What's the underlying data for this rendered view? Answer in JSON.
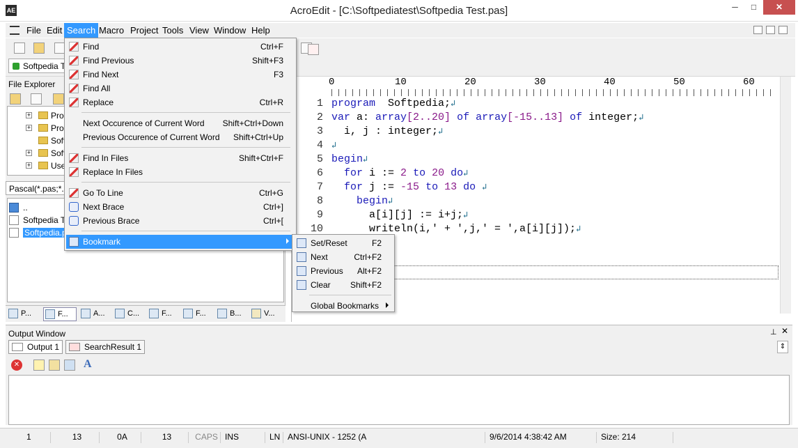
{
  "window": {
    "title": "AcroEdit - [C:\\Softpediatest\\Softpedia Test.pas]",
    "minimize": "─",
    "maximize": "□",
    "close": "✕",
    "app_icon": "AE"
  },
  "menubar": {
    "items": [
      "File",
      "Edit",
      "Search",
      "Macro",
      "Project",
      "Tools",
      "View",
      "Window",
      "Help"
    ],
    "active": "Search"
  },
  "doc_tab": {
    "label": "Softpedia T"
  },
  "file_explorer": {
    "title": "File Explorer",
    "tree": [
      "Prog",
      "Prog",
      "Soft",
      "Soft",
      "Use"
    ],
    "filter": "Pascal(*.pas;*.d",
    "files": [
      {
        "label": "..",
        "selected": false
      },
      {
        "label": "Softpedia T",
        "selected": false
      },
      {
        "label": "Softpedia.p",
        "selected": true
      }
    ],
    "panel_tabs": [
      "P...",
      "F...",
      "A...",
      "C...",
      "F...",
      "F...",
      "B...",
      "V..."
    ]
  },
  "editor": {
    "ruler_labels": [
      "0",
      "10",
      "20",
      "30",
      "40",
      "50",
      "60"
    ],
    "lines": [
      {
        "n": "1",
        "parts": [
          [
            "kw",
            "program"
          ],
          [
            "",
            "  Softpedia;"
          ],
          [
            "ret",
            "↲"
          ]
        ]
      },
      {
        "n": "2",
        "parts": [
          [
            "kw",
            "var"
          ],
          [
            "",
            " a: "
          ],
          [
            "kw",
            "array"
          ],
          [
            "num",
            "[2..20]"
          ],
          [
            "",
            " "
          ],
          [
            "kw",
            "of"
          ],
          [
            "",
            " "
          ],
          [
            "kw",
            "array"
          ],
          [
            "num",
            "[-15..13]"
          ],
          [
            "",
            " "
          ],
          [
            "kw",
            "of"
          ],
          [
            "",
            " integer;"
          ],
          [
            "ret",
            "↲"
          ]
        ]
      },
      {
        "n": "3",
        "parts": [
          [
            "",
            "  i, j : integer;"
          ],
          [
            "ret",
            "↲"
          ]
        ]
      },
      {
        "n": "4",
        "parts": [
          [
            "ret",
            "↲"
          ]
        ]
      },
      {
        "n": "5",
        "parts": [
          [
            "kw",
            "begin"
          ],
          [
            "ret",
            "↲"
          ]
        ]
      },
      {
        "n": "6",
        "parts": [
          [
            "",
            "  "
          ],
          [
            "kw",
            "for"
          ],
          [
            "",
            " i := "
          ],
          [
            "num",
            "2"
          ],
          [
            "",
            " "
          ],
          [
            "kw",
            "to"
          ],
          [
            "",
            " "
          ],
          [
            "num",
            "20"
          ],
          [
            "",
            " "
          ],
          [
            "kw",
            "do"
          ],
          [
            "ret",
            "↲"
          ]
        ]
      },
      {
        "n": "7",
        "parts": [
          [
            "",
            "  "
          ],
          [
            "kw",
            "for"
          ],
          [
            "",
            " j := "
          ],
          [
            "num",
            "-15"
          ],
          [
            "",
            " "
          ],
          [
            "kw",
            "to"
          ],
          [
            "",
            " "
          ],
          [
            "num",
            "13"
          ],
          [
            "",
            " "
          ],
          [
            "kw",
            "do"
          ],
          [
            "",
            " "
          ],
          [
            "ret",
            "↲"
          ]
        ]
      },
      {
        "n": "8",
        "parts": [
          [
            "",
            "    "
          ],
          [
            "kw",
            "begin"
          ],
          [
            "ret",
            "↲"
          ]
        ]
      },
      {
        "n": "9",
        "parts": [
          [
            "",
            "      a[i][j] := i+j;"
          ],
          [
            "ret",
            "↲"
          ]
        ]
      },
      {
        "n": "10",
        "parts": [
          [
            "",
            "      writeln(i,' + ',j,' = ',a[i][j]);"
          ],
          [
            "ret",
            "↲"
          ]
        ]
      }
    ]
  },
  "search_menu": {
    "items": [
      {
        "label": "Find",
        "shortcut": "Ctrl+F",
        "icon": "find-icon"
      },
      {
        "label": "Find Previous",
        "shortcut": "Shift+F3",
        "icon": "find-previous-icon"
      },
      {
        "label": "Find Next",
        "shortcut": "F3",
        "icon": "find-next-icon"
      },
      {
        "label": "Find All",
        "shortcut": "",
        "icon": "find-all-icon"
      },
      {
        "label": "Replace",
        "shortcut": "Ctrl+R",
        "icon": "replace-icon"
      },
      {
        "sep": true
      },
      {
        "label": "Next Occurence of Current Word",
        "shortcut": "Shift+Ctrl+Down",
        "icon": ""
      },
      {
        "label": "Previous Occurence of Current Word",
        "shortcut": "Shift+Ctrl+Up",
        "icon": ""
      },
      {
        "sep": true
      },
      {
        "label": "Find In Files",
        "shortcut": "Shift+Ctrl+F",
        "icon": "find-in-files-icon"
      },
      {
        "label": "Replace In Files",
        "shortcut": "",
        "icon": "replace-in-files-icon"
      },
      {
        "sep": true
      },
      {
        "label": "Go To Line",
        "shortcut": "Ctrl+G",
        "icon": "go-to-line-icon"
      },
      {
        "label": "Next Brace",
        "shortcut": "Ctrl+]",
        "icon": "next-brace-icon"
      },
      {
        "label": "Previous Brace",
        "shortcut": "Ctrl+[",
        "icon": "previous-brace-icon"
      },
      {
        "sep": true
      },
      {
        "label": "Bookmark",
        "shortcut": "",
        "icon": "bookmark-icon",
        "submenu": true,
        "highlighted": true
      }
    ]
  },
  "bookmark_submenu": {
    "items": [
      {
        "label": "Set/Reset",
        "shortcut": "F2"
      },
      {
        "label": "Next",
        "shortcut": "Ctrl+F2"
      },
      {
        "label": "Previous",
        "shortcut": "Alt+F2"
      },
      {
        "label": "Clear",
        "shortcut": "Shift+F2"
      },
      {
        "label": "Global Bookmarks",
        "shortcut": "",
        "submenu": true
      }
    ]
  },
  "output_window": {
    "title": "Output Window",
    "tabs": [
      "Output 1",
      "SearchResult 1"
    ]
  },
  "statusbar": {
    "fields": [
      "1",
      "13",
      "0A",
      "13",
      "CAPS",
      "INS",
      "LN",
      "ANSI-UNIX - 1252  (A",
      "9/6/2014 4:38:42 AM",
      "Size: 214"
    ]
  }
}
